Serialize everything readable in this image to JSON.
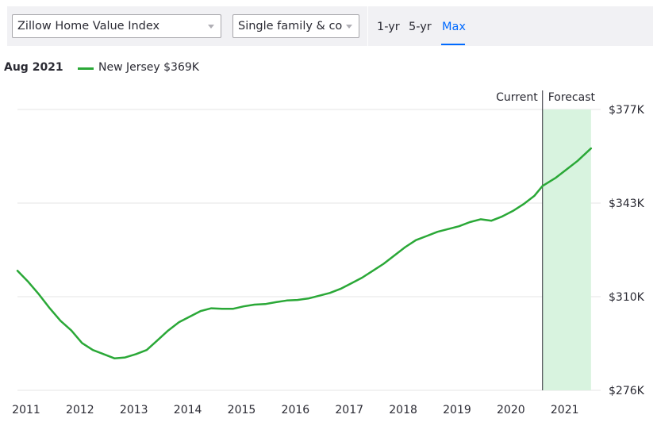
{
  "toolbar": {
    "index_select": {
      "value": "Zillow Home Value Index",
      "icon": "chevron-down-icon"
    },
    "home_type_select": {
      "value": "Single family & cor",
      "icon": "chevron-down-icon"
    },
    "range_tabs": [
      {
        "label": "1-yr",
        "active": false
      },
      {
        "label": "5-yr",
        "active": false
      },
      {
        "label": "Max",
        "active": true
      }
    ]
  },
  "legend": {
    "date": "Aug 2021",
    "series_label": "New Jersey $369K"
  },
  "colors": {
    "line": "#2aa837",
    "forecast_band": "#d8f3df",
    "accent": "#006aff",
    "grid": "#e6e6e6"
  },
  "chart_data": {
    "type": "line",
    "title": "",
    "xlabel": "",
    "ylabel": "",
    "x_ticks": [
      "2011",
      "2012",
      "2013",
      "2014",
      "2015",
      "2016",
      "2017",
      "2018",
      "2019",
      "2020",
      "2021"
    ],
    "y_ticks": [
      "$377K",
      "$343K",
      "$310K",
      "$276K"
    ],
    "xlim": [
      2011.0,
      2021.8
    ],
    "ylim": [
      276,
      377
    ],
    "grid": true,
    "legend_position": "top-left",
    "current_label": "Current",
    "forecast_label": "Forecast",
    "current_divider_x": 2020.75,
    "forecast_range": [
      2020.75,
      2021.65
    ],
    "series": [
      {
        "name": "New Jersey",
        "points": [
          [
            2011.0,
            319.0
          ],
          [
            2011.2,
            315.0
          ],
          [
            2011.4,
            310.5
          ],
          [
            2011.6,
            305.5
          ],
          [
            2011.8,
            301.0
          ],
          [
            2012.0,
            297.5
          ],
          [
            2012.2,
            293.0
          ],
          [
            2012.4,
            290.5
          ],
          [
            2012.6,
            289.0
          ],
          [
            2012.8,
            287.5
          ],
          [
            2013.0,
            287.8
          ],
          [
            2013.2,
            289.0
          ],
          [
            2013.4,
            290.5
          ],
          [
            2013.6,
            294.0
          ],
          [
            2013.8,
            297.5
          ],
          [
            2014.0,
            300.5
          ],
          [
            2014.2,
            302.5
          ],
          [
            2014.4,
            304.5
          ],
          [
            2014.6,
            305.5
          ],
          [
            2014.8,
            305.3
          ],
          [
            2015.0,
            305.3
          ],
          [
            2015.2,
            306.2
          ],
          [
            2015.4,
            306.8
          ],
          [
            2015.6,
            307.0
          ],
          [
            2015.8,
            307.7
          ],
          [
            2016.0,
            308.3
          ],
          [
            2016.2,
            308.5
          ],
          [
            2016.4,
            309.0
          ],
          [
            2016.6,
            310.0
          ],
          [
            2016.8,
            311.0
          ],
          [
            2017.0,
            312.5
          ],
          [
            2017.2,
            314.5
          ],
          [
            2017.4,
            316.5
          ],
          [
            2017.6,
            319.0
          ],
          [
            2017.8,
            321.5
          ],
          [
            2018.0,
            324.5
          ],
          [
            2018.2,
            327.5
          ],
          [
            2018.4,
            330.0
          ],
          [
            2018.6,
            331.5
          ],
          [
            2018.8,
            333.0
          ],
          [
            2019.0,
            334.0
          ],
          [
            2019.2,
            335.0
          ],
          [
            2019.4,
            336.5
          ],
          [
            2019.6,
            337.5
          ],
          [
            2019.8,
            337.0
          ],
          [
            2020.0,
            338.5
          ],
          [
            2020.2,
            340.5
          ],
          [
            2020.4,
            343.0
          ],
          [
            2020.6,
            346.0
          ],
          [
            2020.75,
            349.5
          ],
          [
            2021.0,
            352.5
          ],
          [
            2021.2,
            355.5
          ],
          [
            2021.4,
            358.5
          ],
          [
            2021.65,
            363.0
          ]
        ]
      }
    ]
  }
}
